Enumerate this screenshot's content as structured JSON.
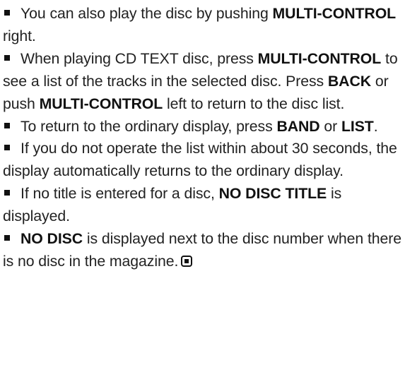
{
  "notes": [
    {
      "parts": [
        {
          "text": "You can also play the disc by pushing ",
          "bold": false
        },
        {
          "text": "MULTI-CONTROL",
          "bold": true
        },
        {
          "text": " right.",
          "bold": false
        }
      ]
    },
    {
      "parts": [
        {
          "text": "When playing CD TEXT disc, press ",
          "bold": false
        },
        {
          "text": "MULTI-CONTROL",
          "bold": true
        },
        {
          "text": " to see a list of the tracks in the selected disc. Press ",
          "bold": false
        },
        {
          "text": "BACK",
          "bold": true
        },
        {
          "text": " or push ",
          "bold": false
        },
        {
          "text": "MULTI-CONTROL",
          "bold": true
        },
        {
          "text": " left to return to the disc list.",
          "bold": false
        }
      ]
    },
    {
      "parts": [
        {
          "text": "To return to the ordinary display, press ",
          "bold": false
        },
        {
          "text": "BAND",
          "bold": true
        },
        {
          "text": " or ",
          "bold": false
        },
        {
          "text": "LIST",
          "bold": true
        },
        {
          "text": ".",
          "bold": false
        }
      ]
    },
    {
      "parts": [
        {
          "text": "If you do not operate the list within about 30 seconds, the display automatically returns to the ordinary display.",
          "bold": false
        }
      ]
    },
    {
      "parts": [
        {
          "text": "If no title is entered for a disc, ",
          "bold": false
        },
        {
          "text": "NO DISC TITLE",
          "bold": true
        },
        {
          "text": " is displayed.",
          "bold": false
        }
      ]
    },
    {
      "parts": [
        {
          "text": "NO DISC",
          "bold": true
        },
        {
          "text": " is displayed next to the disc number when there is no disc in the magazine.",
          "bold": false
        }
      ],
      "end_mark": true
    }
  ],
  "icons": {
    "bullet": "square-bullet-icon",
    "end_mark": "end-of-section-icon"
  }
}
